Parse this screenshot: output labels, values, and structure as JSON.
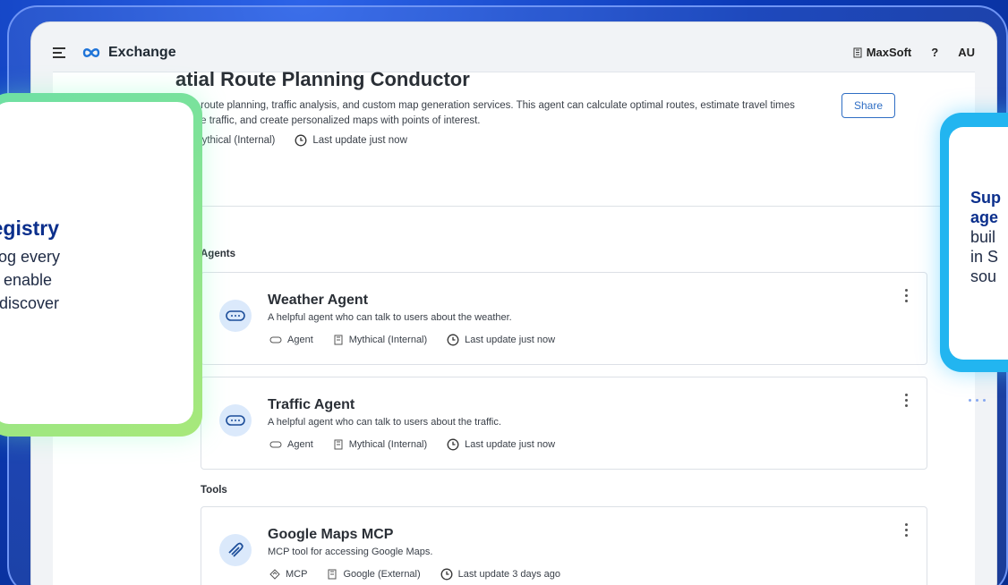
{
  "header": {
    "app_name": "Exchange",
    "org_name": "MaxSoft",
    "help_label": "?",
    "user_initials": "AU"
  },
  "asset": {
    "title": "atial Route Planning Conductor",
    "description_line1": "nced route planning, traffic analysis, and custom map generation services. This agent can calculate optimal routes, estimate travel times",
    "description_line2": "al-time traffic, and create personalized maps with points of interest.",
    "org": "Mythical (Internal)",
    "updated": "Last update just now",
    "share_label": "Share"
  },
  "sections": {
    "agents_label": "Agents",
    "tools_label": "Tools"
  },
  "agents": [
    {
      "name": "Weather Agent",
      "description": "A helpful agent who can talk to users about the weather.",
      "type": "Agent",
      "org": "Mythical (Internal)",
      "updated": "Last update just now"
    },
    {
      "name": "Traffic Agent",
      "description": "A helpful agent who can talk to users about the traffic.",
      "type": "Agent",
      "org": "Mythical (Internal)",
      "updated": "Last update just now"
    }
  ],
  "tools": [
    {
      "name": "Google Maps MCP",
      "description": "MCP tool for accessing Google Maps.",
      "type": "MCP",
      "org": "Google (External)",
      "updated": "Last update 3 days ago"
    }
  ],
  "callout_left": {
    "title": "Registry",
    "body": "alog every\nto enable\no discover"
  },
  "callout_right": {
    "title": "Sup\nage",
    "body": "buil\nin S\nsou"
  }
}
